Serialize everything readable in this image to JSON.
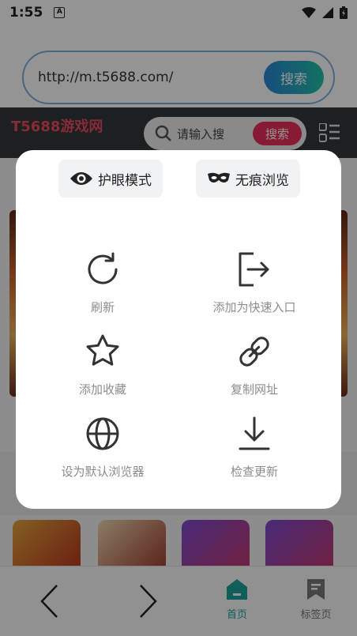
{
  "status_bar": {
    "time": "1:55",
    "badge": "A"
  },
  "browser": {
    "url": "http://m.t5688.com/",
    "search_label": "搜索"
  },
  "site": {
    "logo": "T5688游戏网",
    "search_placeholder": "请输入搜",
    "search_label": "搜索"
  },
  "menu": {
    "eye_mode": "护眼模式",
    "incognito": "无痕浏览",
    "actions": [
      {
        "label": "刷新",
        "icon": "refresh-icon"
      },
      {
        "label": "添加为快速入口",
        "icon": "add-shortcut-icon"
      },
      {
        "label": "添加收藏",
        "icon": "star-icon"
      },
      {
        "label": "复制网址",
        "icon": "link-icon"
      },
      {
        "label": "设为默认浏览器",
        "icon": "globe-icon"
      },
      {
        "label": "检查更新",
        "icon": "download-icon"
      }
    ]
  },
  "bottom_nav": {
    "home": "首页",
    "bookmarks": "标签页"
  },
  "colors": {
    "accent_green": "#1aa39a",
    "search_blue": "#2a86d8",
    "site_red": "#e8305a"
  }
}
